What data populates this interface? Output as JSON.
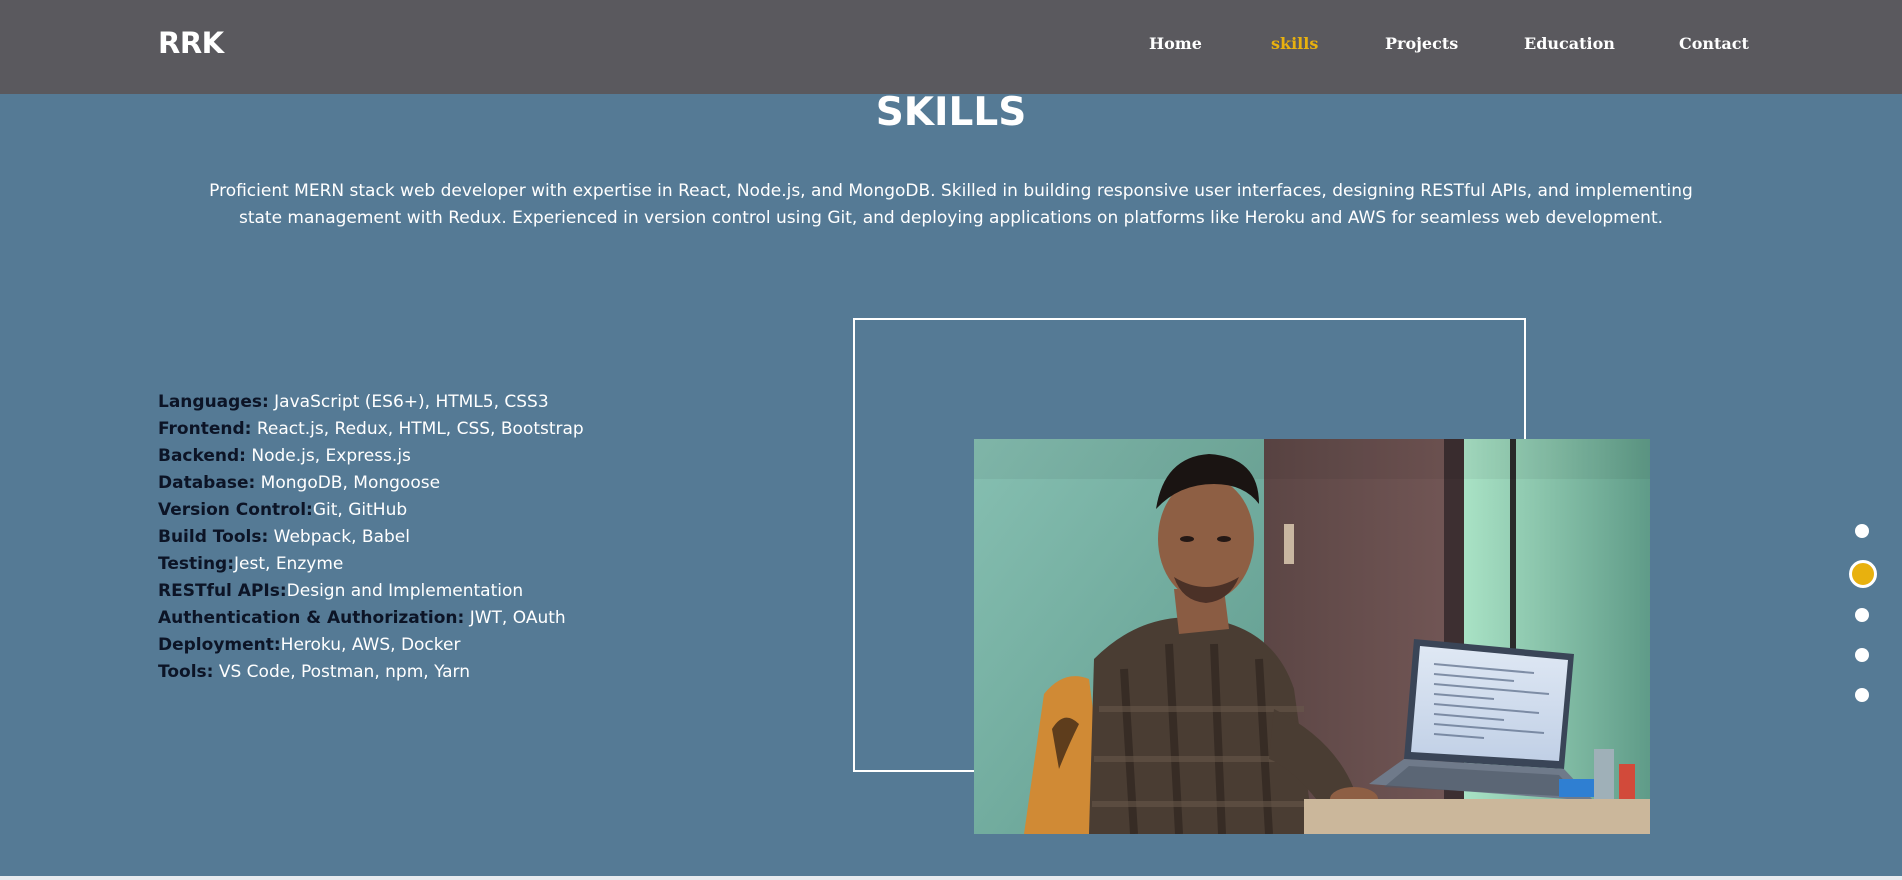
{
  "brand": "RRK",
  "nav": [
    {
      "label": "Home",
      "active": false
    },
    {
      "label": "skills",
      "active": true
    },
    {
      "label": "Projects",
      "active": false
    },
    {
      "label": "Education",
      "active": false
    },
    {
      "label": "Contact",
      "active": false
    }
  ],
  "section": {
    "title": "SKILLS",
    "intro": "Proficient MERN stack web developer with expertise in React, Node.js, and MongoDB. Skilled in building responsive user interfaces, designing RESTful APIs, and implementing state management with Redux. Experienced in version control using Git, and deploying applications on platforms like Heroku and AWS for seamless web development."
  },
  "skills": [
    {
      "label": "Languages:",
      "value": " JavaScript (ES6+), HTML5, CSS3"
    },
    {
      "label": "Frontend:",
      "value": " React.js, Redux, HTML, CSS, Bootstrap"
    },
    {
      "label": "Backend:",
      "value": " Node.js, Express.js"
    },
    {
      "label": "Database:",
      "value": " MongoDB, Mongoose"
    },
    {
      "label": "Version Control:",
      "value": "Git, GitHub"
    },
    {
      "label": "Build Tools:",
      "value": " Webpack, Babel"
    },
    {
      "label": "Testing:",
      "value": "Jest, Enzyme"
    },
    {
      "label": "RESTful APIs:",
      "value": "Design and Implementation"
    },
    {
      "label": "Authentication & Authorization:",
      "value": " JWT, OAuth"
    },
    {
      "label": "Deployment:",
      "value": "Heroku, AWS, Docker"
    },
    {
      "label": "Tools:",
      "value": " VS Code, Postman, npm, Yarn"
    }
  ],
  "photo": {
    "alt": "Profile photo at laptop"
  },
  "dot_nav": {
    "count": 5,
    "active_index": 1
  },
  "colors": {
    "background": "#557a95",
    "header": "#5a595e",
    "accent": "#e8b10e",
    "skill_key": "#0c1426"
  }
}
